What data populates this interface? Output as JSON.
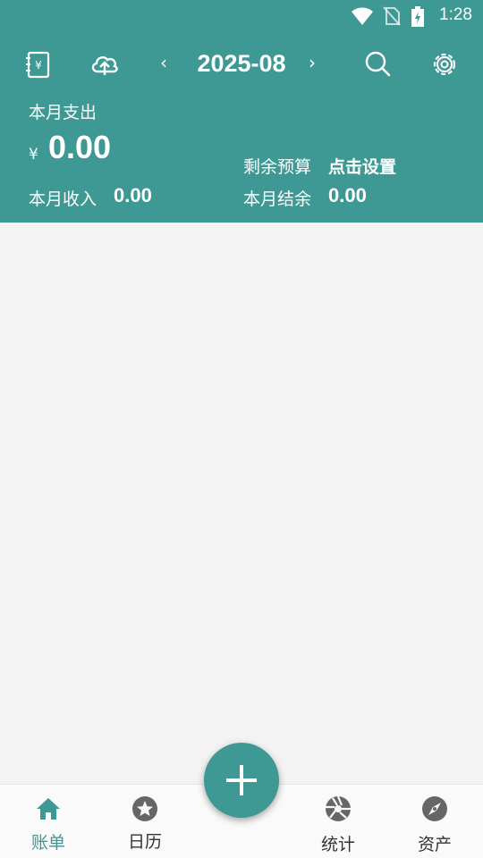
{
  "status_bar": {
    "time": "1:28",
    "icons": [
      "wifi-icon",
      "no-sim-icon",
      "battery-charging-icon"
    ]
  },
  "toolbar": {
    "month": "2025-08",
    "prev_arrow": "‹",
    "next_arrow": "›",
    "icons": [
      "ledger-book-icon",
      "cloud-upload-icon",
      "search-icon",
      "gear-icon"
    ]
  },
  "summary": {
    "expense_label": "本月支出",
    "currency": "¥",
    "expense_amount": "0.00",
    "budget_label": "剩余预算",
    "budget_value": "点击设置",
    "income_label": "本月收入",
    "income_value": "0.00",
    "balance_label": "本月结余",
    "balance_value": "0.00"
  },
  "colors": {
    "accent": "#3e9894",
    "background": "#f3f3f3",
    "nav_inactive": "#666666"
  },
  "bottom_nav": {
    "items": [
      {
        "label": "账单",
        "icon": "home-icon",
        "active": true
      },
      {
        "label": "日历",
        "icon": "star-icon",
        "active": false
      },
      {
        "label": "统计",
        "icon": "aperture-icon",
        "active": false
      },
      {
        "label": "资产",
        "icon": "compass-icon",
        "active": false
      }
    ]
  },
  "fab": {
    "icon": "plus-icon"
  }
}
